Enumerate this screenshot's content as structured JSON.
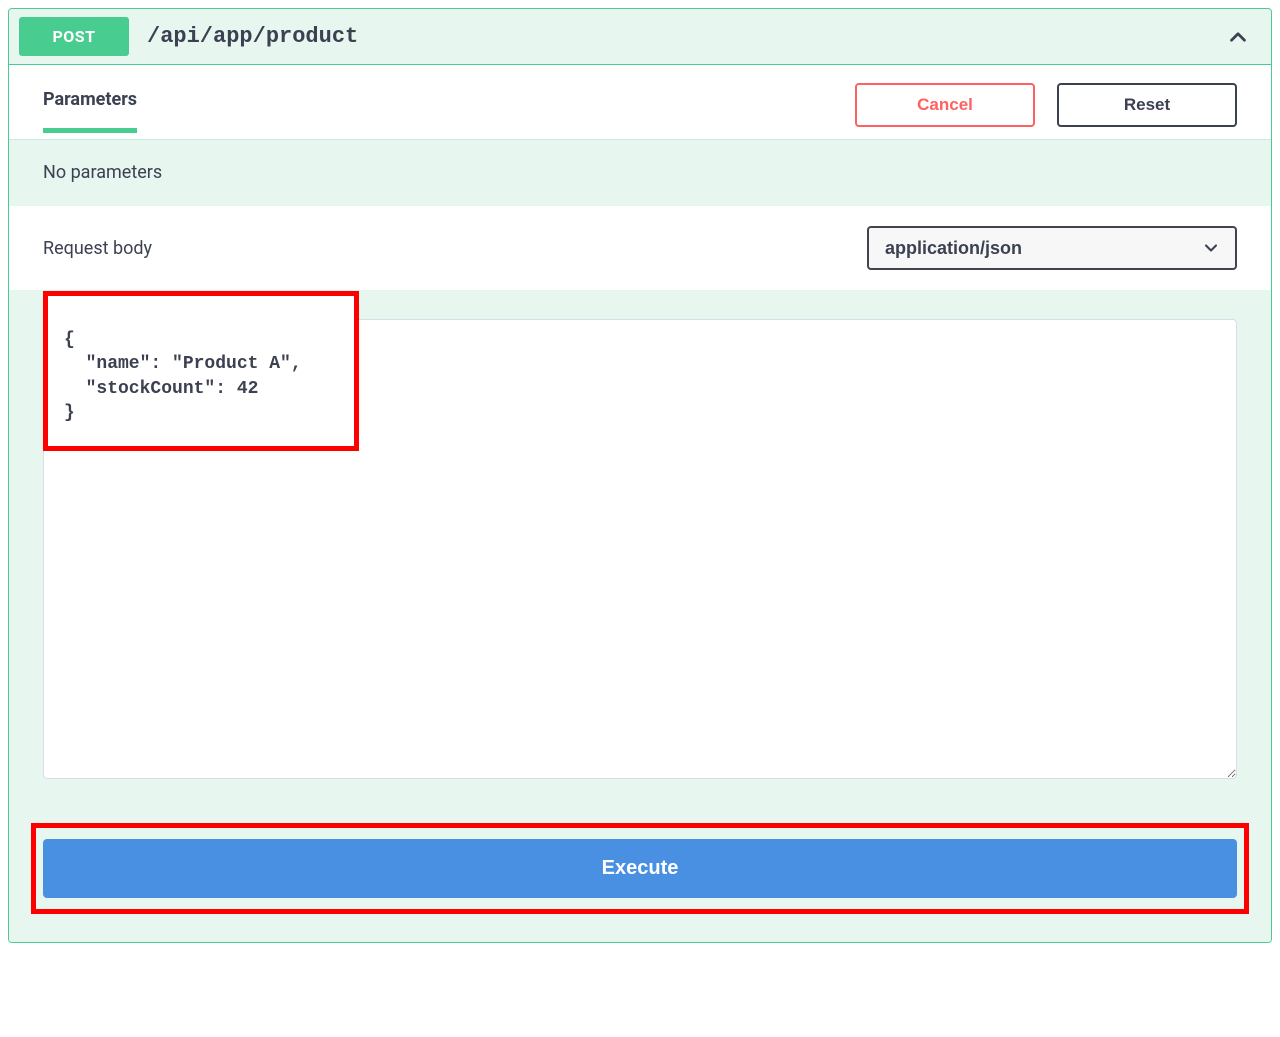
{
  "summary": {
    "method": "POST",
    "path": "/api/app/product"
  },
  "tabs": {
    "parameters": "Parameters"
  },
  "buttons": {
    "cancel": "Cancel",
    "reset": "Reset",
    "execute": "Execute"
  },
  "params": {
    "empty_message": "No parameters"
  },
  "request_body": {
    "label": "Request body",
    "content_type": "application/json",
    "value": "{\n  \"name\": \"Product A\",\n  \"stockCount\": 42\n}"
  }
}
